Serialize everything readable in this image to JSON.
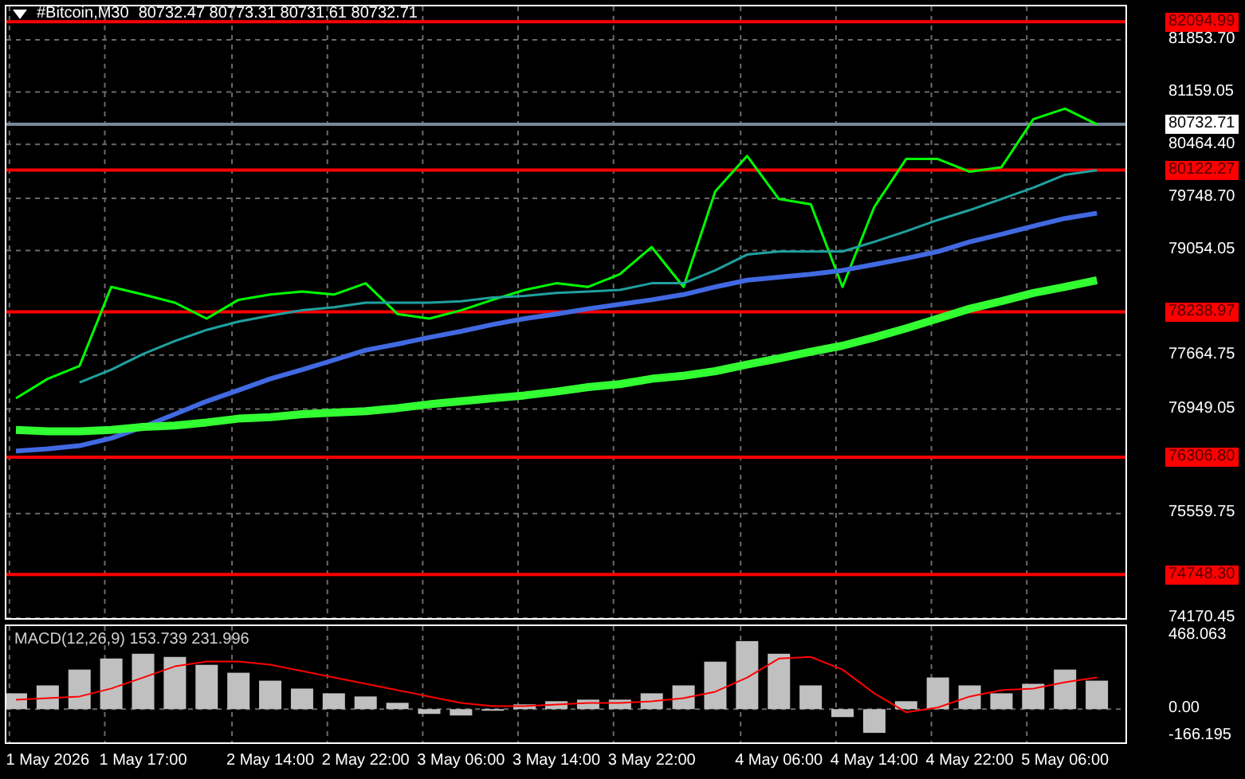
{
  "header": {
    "symbol": "#Bitcoin,M30",
    "quote": "80732.47 80773.31 80731.61 80732.71"
  },
  "price_chart": {
    "chart_data": {
      "type": "line",
      "categories": [
        null,
        null,
        null,
        null,
        null,
        null,
        null,
        null,
        null,
        null,
        null,
        null,
        null,
        null,
        null,
        null,
        null,
        null,
        null,
        null,
        null,
        null,
        null,
        null,
        null,
        null,
        null,
        null,
        null,
        null,
        null,
        null,
        null,
        null,
        null
      ],
      "ylim": [
        74170,
        82298
      ],
      "grid": true,
      "yticks": [
        {
          "value": 81853.7,
          "label": "81853.70"
        },
        {
          "value": 81159.05,
          "label": "81159.05"
        },
        {
          "value": 80464.4,
          "label": "80464.40"
        },
        {
          "value": 79748.7,
          "label": "79748.70"
        },
        {
          "value": 79054.05,
          "label": "79054.05"
        },
        {
          "value": 77664.75,
          "label": "77664.75"
        },
        {
          "value": 76949.05,
          "label": "76949.05"
        },
        {
          "value": 75559.75,
          "label": "75559.75"
        },
        {
          "value": 74170.45,
          "label": "74170.45"
        }
      ],
      "series": [
        {
          "color": "#00ff00",
          "values": [
            77090,
            77350,
            77520,
            78570,
            78470,
            78360,
            78150,
            78400,
            78470,
            78510,
            78470,
            78620,
            78210,
            78150,
            78260,
            78400,
            78530,
            78620,
            78570,
            78740,
            79100,
            78570,
            79840,
            80310,
            79740,
            79670,
            78570,
            79630,
            80270,
            80270,
            80100,
            80160,
            80800,
            80940,
            80730
          ]
        },
        {
          "color": "#20a0a0",
          "values": [
            null,
            null,
            77300,
            77470,
            77680,
            77850,
            78000,
            78110,
            78190,
            78260,
            78300,
            78360,
            78360,
            78360,
            78380,
            78430,
            78450,
            78490,
            78510,
            78530,
            78620,
            78620,
            78790,
            79000,
            79040,
            79040,
            79040,
            79170,
            79310,
            79460,
            79590,
            79740,
            79890,
            80060,
            80120
          ]
        },
        {
          "color": "#4169e1",
          "values": [
            76390,
            76420,
            76460,
            76560,
            76710,
            76880,
            77050,
            77200,
            77350,
            77470,
            77600,
            77730,
            77810,
            77900,
            77980,
            78070,
            78150,
            78210,
            78280,
            78340,
            78400,
            78470,
            78570,
            78660,
            78700,
            78740,
            78790,
            78870,
            78950,
            79040,
            79170,
            79270,
            79380,
            79480,
            79550
          ]
        },
        {
          "color": "#32ff32",
          "values": [
            76670,
            76650,
            76650,
            76670,
            76710,
            76730,
            76770,
            76820,
            76840,
            76880,
            76900,
            76920,
            76960,
            77010,
            77050,
            77090,
            77130,
            77180,
            77240,
            77280,
            77350,
            77390,
            77450,
            77540,
            77620,
            77710,
            77790,
            77900,
            78020,
            78150,
            78280,
            78380,
            78490,
            78570,
            78660
          ]
        }
      ],
      "ref_lines": [
        {
          "axis": "y",
          "value": 82094.99,
          "label": "82094.99",
          "color": "#ff0000"
        },
        {
          "axis": "y",
          "value": 80732.71,
          "label": "80732.71",
          "color": "#778899"
        },
        {
          "axis": "y",
          "value": 80122.27,
          "label": "80122.27",
          "color": "#ff0000"
        },
        {
          "axis": "y",
          "value": 78238.97,
          "label": "78238.97",
          "color": "#ff0000"
        },
        {
          "axis": "y",
          "value": 76306.8,
          "label": "76306.80",
          "color": "#ff0000"
        },
        {
          "axis": "y",
          "value": 74748.3,
          "label": "74748.30",
          "color": "#ff0000"
        }
      ]
    }
  },
  "macd": {
    "label": "MACD(12,26,9) 153.739 231.996",
    "chart_data": {
      "type": "bar",
      "categories": [
        null,
        "1 May 2026",
        null,
        null,
        "1 May 17:00",
        null,
        null,
        null,
        "2 May 14:00",
        null,
        null,
        "2 May 22:00",
        null,
        null,
        "3 May 06:00",
        null,
        null,
        "3 May 14:00",
        null,
        null,
        "3 May 22:00",
        null,
        null,
        null,
        "4 May 06:00",
        null,
        null,
        "4 May 14:00",
        null,
        null,
        "4 May 22:00",
        null,
        null,
        "5 May 06:00",
        null
      ],
      "ylim": [
        -210,
        525
      ],
      "grid": true,
      "yticks": [
        {
          "value": 468.063,
          "label": "468.063"
        },
        {
          "value": 0,
          "label": "0.00"
        },
        {
          "value": -166.195,
          "label": "-166.195"
        }
      ],
      "series": [
        {
          "color": "#c0c0c0",
          "values": [
            100,
            150,
            250,
            320,
            350,
            330,
            280,
            230,
            180,
            130,
            100,
            80,
            40,
            -30,
            -40,
            0,
            30,
            50,
            60,
            60,
            100,
            150,
            300,
            430,
            350,
            150,
            -50,
            -150,
            50,
            200,
            150,
            100,
            160,
            250,
            180
          ]
        },
        {
          "type": "line",
          "color": "#ff0000",
          "values": [
            60,
            70,
            80,
            130,
            200,
            270,
            300,
            300,
            280,
            240,
            200,
            160,
            120,
            80,
            40,
            20,
            20,
            30,
            40,
            40,
            50,
            70,
            110,
            200,
            320,
            330,
            250,
            100,
            -20,
            10,
            80,
            120,
            130,
            170,
            200
          ]
        }
      ]
    }
  }
}
